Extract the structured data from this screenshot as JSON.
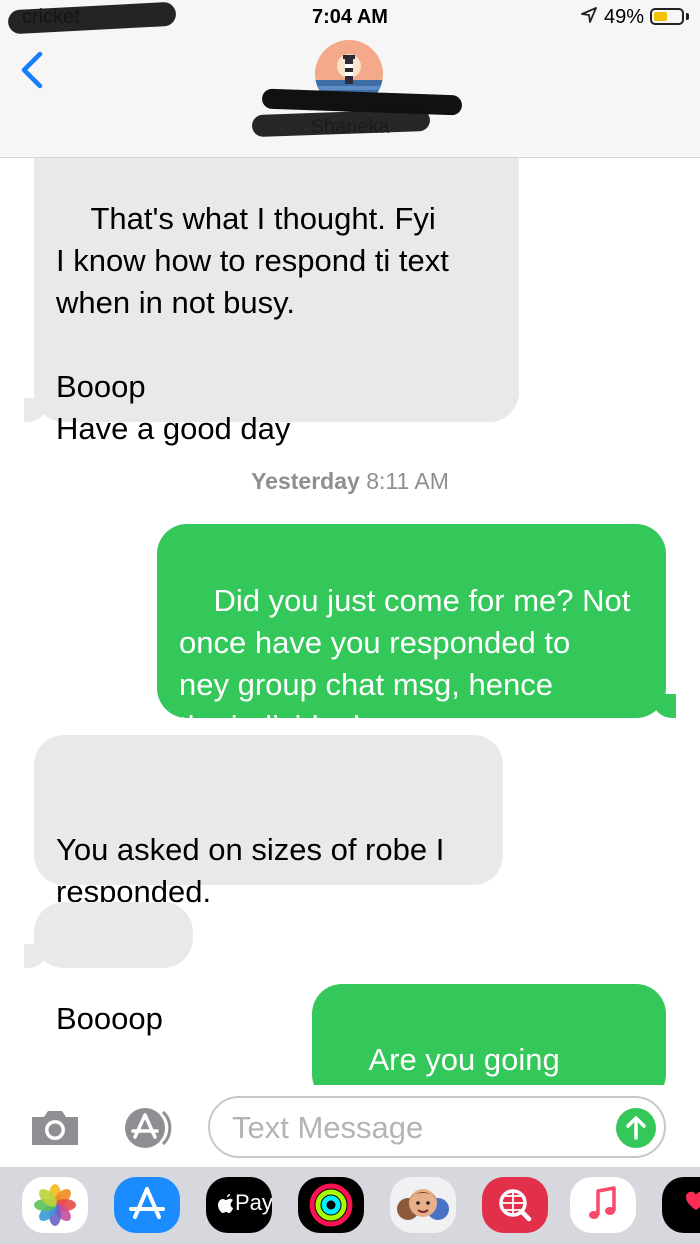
{
  "status_bar": {
    "carrier": "cricket",
    "time": "7:04 AM",
    "battery_percent": "49%",
    "battery_level": 0.49
  },
  "header": {
    "contact_name": "Shaneka"
  },
  "conversation": {
    "messages": [
      {
        "direction": "received",
        "text": "That's what I thought. Fyi\nI know how to respond ti text\nwhen in not busy.\n\nBooop\nHave a good day"
      },
      {
        "direction": "sent",
        "text": "Did you just come for me? Not\nonce have you responded to\nney group chat msg, hence\nthe individual msg"
      },
      {
        "direction": "received",
        "text": "\nYou asked on sizes of robe I\nresponded."
      },
      {
        "direction": "received",
        "text": "Boooop"
      },
      {
        "direction": "sent",
        "text": "Are you going threw\nsomething sis"
      }
    ],
    "timestamp": {
      "day": "Yesterday",
      "time": "8:11 AM"
    }
  },
  "input": {
    "placeholder": "Text Message"
  },
  "drawer": {
    "apps": [
      {
        "name": "photos-icon"
      },
      {
        "name": "app-store-icon"
      },
      {
        "name": "apple-pay-icon",
        "label": "Pay"
      },
      {
        "name": "activity-icon"
      },
      {
        "name": "memoji-icon"
      },
      {
        "name": "web-search-icon"
      },
      {
        "name": "music-icon"
      },
      {
        "name": "digital-touch-icon"
      }
    ]
  },
  "colors": {
    "sent_bubble": "#34c759",
    "received_bubble": "#e9e9eb",
    "ios_blue": "#147efb"
  }
}
